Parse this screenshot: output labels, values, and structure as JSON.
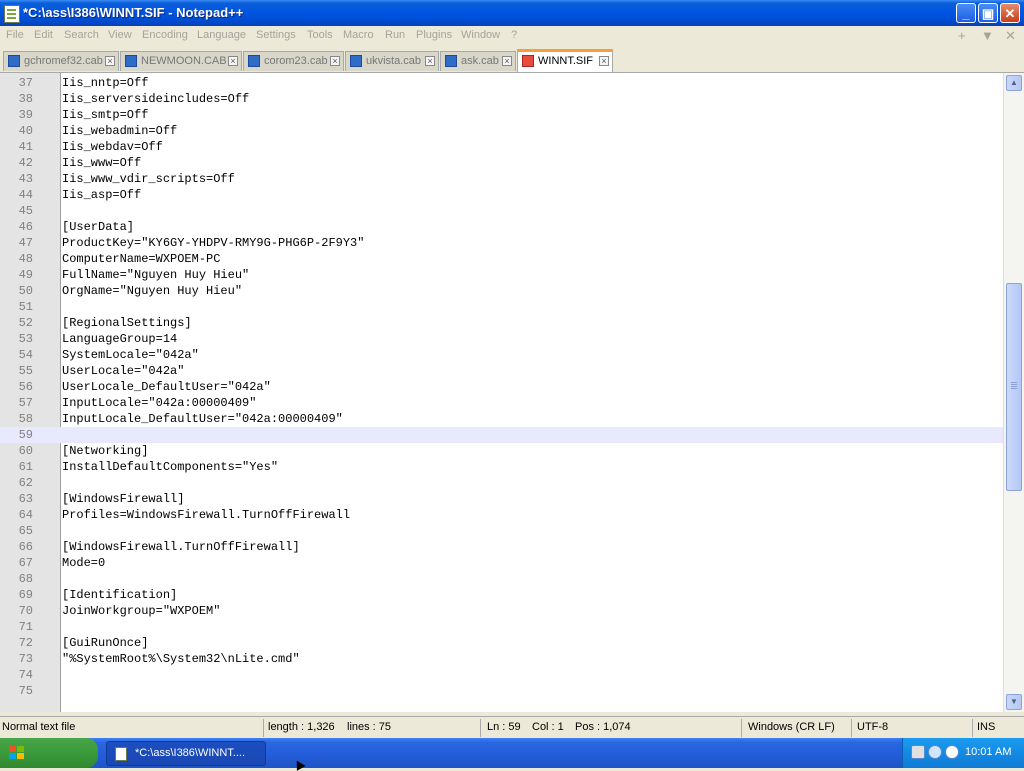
{
  "window": {
    "title": "*C:\\ass\\I386\\WINNT.SIF - Notepad++",
    "minimize": "_",
    "maximize": "▣",
    "close": "✕"
  },
  "menu": [
    "File",
    "Edit",
    "Search",
    "View",
    "Encoding",
    "Language",
    "Settings",
    "Tools",
    "Macro",
    "Run",
    "Plugins",
    "Window",
    "?"
  ],
  "menu_right": {
    "plus": "+",
    "down": "▼",
    "x": "✕"
  },
  "tabs": [
    {
      "label": "gchromef32.cab",
      "active": false
    },
    {
      "label": "NEWMOON.CAB",
      "active": false
    },
    {
      "label": "corom23.cab",
      "active": false
    },
    {
      "label": "ukvista.cab",
      "active": false
    },
    {
      "label": "ask.cab",
      "active": false
    },
    {
      "label": "WINNT.SIF",
      "active": true
    }
  ],
  "editor": {
    "current_line": 59,
    "lines": [
      {
        "n": "37",
        "t": "Iis_nntp=Off"
      },
      {
        "n": "38",
        "t": "Iis_serversideincludes=Off"
      },
      {
        "n": "39",
        "t": "Iis_smtp=Off"
      },
      {
        "n": "40",
        "t": "Iis_webadmin=Off"
      },
      {
        "n": "41",
        "t": "Iis_webdav=Off"
      },
      {
        "n": "42",
        "t": "Iis_www=Off"
      },
      {
        "n": "43",
        "t": "Iis_www_vdir_scripts=Off"
      },
      {
        "n": "44",
        "t": "Iis_asp=Off"
      },
      {
        "n": "45",
        "t": ""
      },
      {
        "n": "46",
        "t": "[UserData]"
      },
      {
        "n": "47",
        "t": "ProductKey=\"KY6GY-YHDPV-RMY9G-PHG6P-2F9Y3\""
      },
      {
        "n": "48",
        "t": "ComputerName=WXPOEM-PC"
      },
      {
        "n": "49",
        "t": "FullName=\"Nguyen Huy Hieu\""
      },
      {
        "n": "50",
        "t": "OrgName=\"Nguyen Huy Hieu\""
      },
      {
        "n": "51",
        "t": ""
      },
      {
        "n": "52",
        "t": "[RegionalSettings]"
      },
      {
        "n": "53",
        "t": "LanguageGroup=14"
      },
      {
        "n": "54",
        "t": "SystemLocale=\"042a\""
      },
      {
        "n": "55",
        "t": "UserLocale=\"042a\""
      },
      {
        "n": "56",
        "t": "UserLocale_DefaultUser=\"042a\""
      },
      {
        "n": "57",
        "t": "InputLocale=\"042a:00000409\""
      },
      {
        "n": "58",
        "t": "InputLocale_DefaultUser=\"042a:00000409\""
      },
      {
        "n": "59",
        "t": ""
      },
      {
        "n": "60",
        "t": "[Networking]"
      },
      {
        "n": "61",
        "t": "InstallDefaultComponents=\"Yes\""
      },
      {
        "n": "62",
        "t": ""
      },
      {
        "n": "63",
        "t": "[WindowsFirewall]"
      },
      {
        "n": "64",
        "t": "Profiles=WindowsFirewall.TurnOffFirewall"
      },
      {
        "n": "65",
        "t": ""
      },
      {
        "n": "66",
        "t": "[WindowsFirewall.TurnOffFirewall]"
      },
      {
        "n": "67",
        "t": "Mode=0"
      },
      {
        "n": "68",
        "t": ""
      },
      {
        "n": "69",
        "t": "[Identification]"
      },
      {
        "n": "70",
        "t": "JoinWorkgroup=\"WXPOEM\""
      },
      {
        "n": "71",
        "t": ""
      },
      {
        "n": "72",
        "t": "[GuiRunOnce]"
      },
      {
        "n": "73",
        "t": "\"%SystemRoot%\\System32\\nLite.cmd\""
      },
      {
        "n": "74",
        "t": ""
      },
      {
        "n": "75",
        "t": ""
      }
    ]
  },
  "scrollbar": {
    "up": "▲",
    "down": "▼"
  },
  "status": {
    "file_type": "Normal text file",
    "length": "length : 1,326",
    "lines": "lines : 75",
    "ln": "Ln : 59",
    "col": "Col : 1",
    "pos": "Pos : 1,074",
    "eol": "Windows (CR LF)",
    "encoding": "UTF-8",
    "mode": "INS"
  },
  "taskbar": {
    "start": "start",
    "task_label": "*C:\\ass\\I386\\WINNT....",
    "clock": "10:01 AM"
  }
}
